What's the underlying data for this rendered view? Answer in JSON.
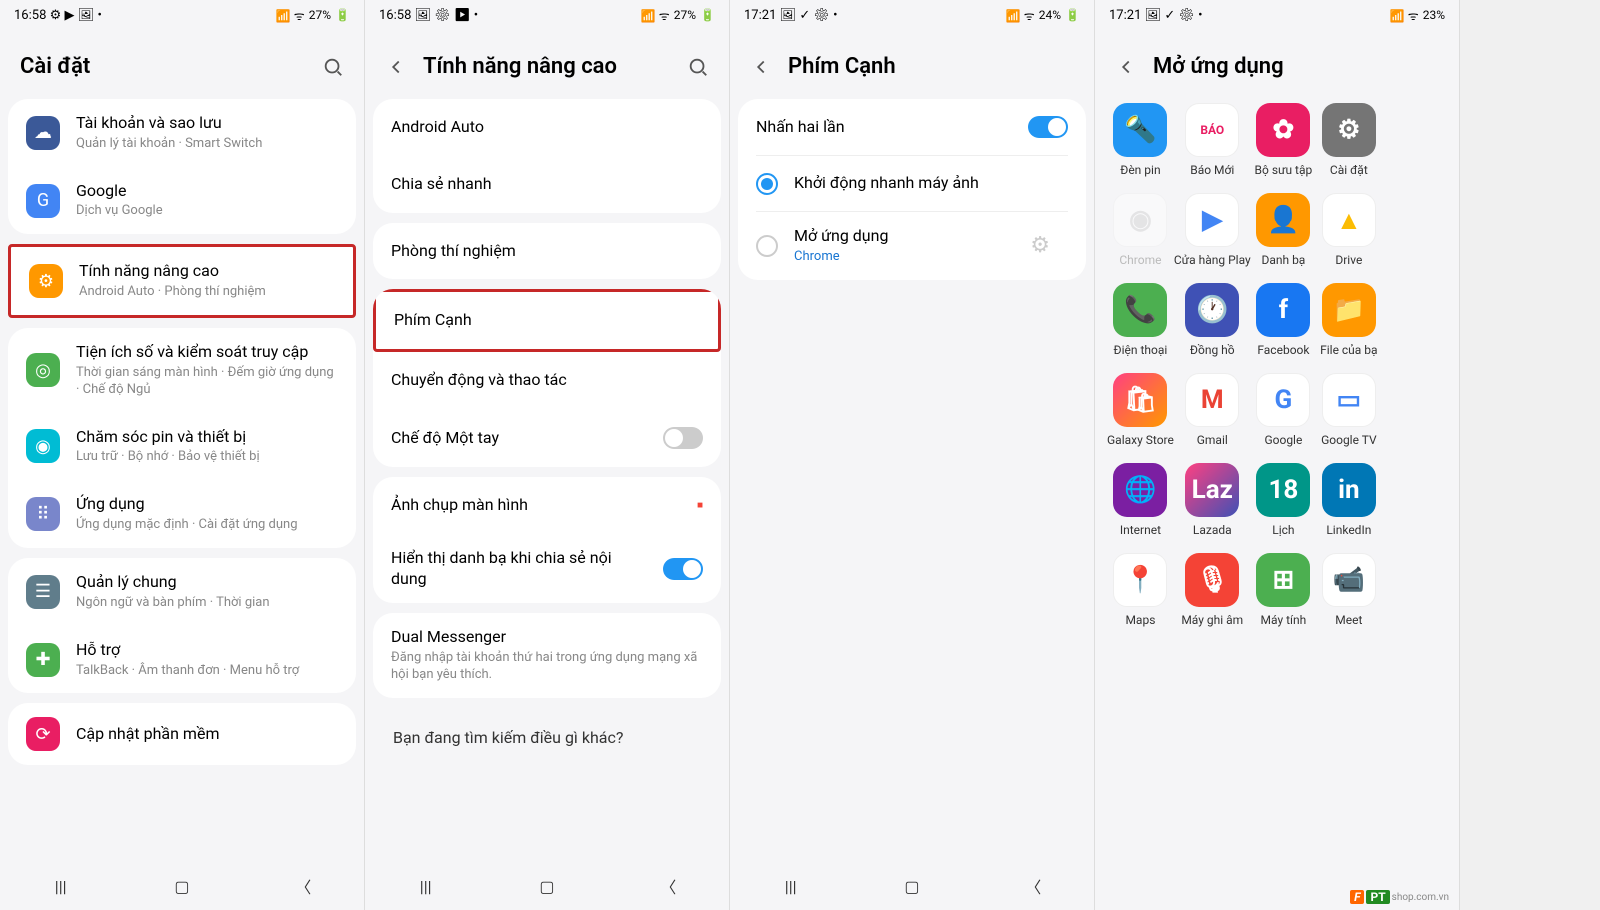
{
  "screen1": {
    "status": {
      "time": "16:58",
      "battery": "27%",
      "icons": "⚙ ▶ 🖼 •"
    },
    "title": "Cài đặt",
    "groups": [
      {
        "items": [
          {
            "icon": "sync",
            "bg": "#3b5998",
            "title": "Tài khoản và sao lưu",
            "sub": "Quản lý tài khoản · Smart Switch"
          },
          {
            "icon": "G",
            "bg": "#4285f4",
            "title": "Google",
            "sub": "Dịch vụ Google"
          }
        ]
      },
      {
        "highlight": true,
        "items": [
          {
            "icon": "gear",
            "bg": "#ff9800",
            "title": "Tính năng nâng cao",
            "sub": "Android Auto · Phòng thí nghiệm"
          }
        ]
      },
      {
        "items": [
          {
            "icon": "wellbeing",
            "bg": "#4caf50",
            "title": "Tiện ích số và kiểm soát truy cập",
            "sub": "Thời gian sáng màn hình · Đếm giờ ứng dụng · Chế độ Ngủ"
          },
          {
            "icon": "care",
            "bg": "#00bcd4",
            "title": "Chăm sóc pin và thiết bị",
            "sub": "Lưu trữ · Bộ nhớ · Bảo vệ thiết bị"
          },
          {
            "icon": "apps",
            "bg": "#7986cb",
            "title": "Ứng dụng",
            "sub": "Ứng dụng mặc định · Cài đặt ứng dụng"
          }
        ]
      },
      {
        "items": [
          {
            "icon": "general",
            "bg": "#607d8b",
            "title": "Quản lý chung",
            "sub": "Ngôn ngữ và bàn phím · Thời gian"
          },
          {
            "icon": "a11y",
            "bg": "#4caf50",
            "title": "Hỗ trợ",
            "sub": "TalkBack · Âm thanh đơn · Menu hỗ trợ"
          }
        ]
      },
      {
        "items": [
          {
            "icon": "update",
            "bg": "#e91e63",
            "title": "Cập nhật phần mềm",
            "sub": ""
          }
        ]
      }
    ]
  },
  "screen2": {
    "status": {
      "time": "16:58",
      "battery": "27%",
      "icons": "🖼 ⚙ ▶ •"
    },
    "title": "Tính năng nâng cao",
    "groups": [
      {
        "items": [
          {
            "title": "Android Auto"
          },
          {
            "title": "Chia sẻ nhanh"
          }
        ]
      },
      {
        "items": [
          {
            "title": "Phòng thí nghiệm"
          }
        ]
      },
      {
        "items": [
          {
            "title": "Phím Cạnh",
            "highlight": true
          },
          {
            "title": "Chuyển động và thao tác"
          },
          {
            "title": "Chế độ Một tay",
            "toggle": "off"
          }
        ]
      },
      {
        "items": [
          {
            "title": "Ảnh chụp màn hình"
          },
          {
            "title": "Hiển thị danh bạ khi chia sẻ nội dung",
            "toggle": "on"
          }
        ]
      },
      {
        "items": [
          {
            "title": "Dual Messenger",
            "sub": "Đăng nhập tài khoản thứ hai trong ứng dụng mạng xã hội bạn yêu thích."
          }
        ]
      }
    ],
    "footer": "Bạn đang tìm kiếm điều gì khác?"
  },
  "screen3": {
    "status": {
      "time": "17:21",
      "battery": "24%",
      "icons": "🖼 ✓ ⚙ •"
    },
    "title": "Phím Cạnh",
    "item1": {
      "title": "Nhấn hai lần",
      "toggle": "on"
    },
    "opt1": {
      "title": "Khởi động nhanh máy ảnh"
    },
    "opt2": {
      "title": "Mở ứng dụng",
      "sub": "Chrome"
    }
  },
  "screen4": {
    "status": {
      "time": "17:21",
      "battery": "23%",
      "icons": "🖼 ✓ ⚙ •"
    },
    "title": "Mở ứng dụng",
    "apps": [
      {
        "label": "Đèn pin",
        "bg": "#2196f3",
        "char": "🔦"
      },
      {
        "label": "Báo Mới",
        "bg": "#fff",
        "char": "BÁO",
        "fg": "#e91e63",
        "small": true
      },
      {
        "label": "Bộ sưu tập",
        "bg": "#e91e63",
        "char": "✿"
      },
      {
        "label": "Cài đặt",
        "bg": "#757575",
        "char": "⚙"
      },
      {
        "label": "",
        "bg": "transparent",
        "char": ""
      },
      {
        "label": "Chrome",
        "bg": "#fff",
        "char": "◉",
        "fg": "#ccc",
        "faded": true
      },
      {
        "label": "Cửa hàng Play",
        "bg": "#fff",
        "char": "▶",
        "fg": "#4285f4"
      },
      {
        "label": "Danh bạ",
        "bg": "#ff9800",
        "char": "👤"
      },
      {
        "label": "Drive",
        "bg": "#fff",
        "char": "▲",
        "fg": "#fbbc04"
      },
      {
        "label": "",
        "bg": "transparent",
        "char": ""
      },
      {
        "label": "Điện thoại",
        "bg": "#4caf50",
        "char": "📞"
      },
      {
        "label": "Đồng hồ",
        "bg": "#3f51b5",
        "char": "🕐"
      },
      {
        "label": "Facebook",
        "bg": "#1877f2",
        "char": "f"
      },
      {
        "label": "File của bạ",
        "bg": "#ff9800",
        "char": "📁"
      },
      {
        "label": "",
        "bg": "transparent",
        "char": ""
      },
      {
        "label": "Galaxy Store",
        "bg": "linear-gradient(135deg,#ff4081,#ff9800)",
        "char": "🛍"
      },
      {
        "label": "Gmail",
        "bg": "#fff",
        "char": "M",
        "fg": "#ea4335"
      },
      {
        "label": "Google",
        "bg": "#fff",
        "char": "G",
        "fg": "#4285f4"
      },
      {
        "label": "Google TV",
        "bg": "#fff",
        "char": "▭",
        "fg": "#4285f4"
      },
      {
        "label": "",
        "bg": "transparent",
        "char": ""
      },
      {
        "label": "Internet",
        "bg": "#7b1fa2",
        "char": "🌐"
      },
      {
        "label": "Lazada",
        "bg": "linear-gradient(135deg,#ff4081,#3f51b5)",
        "char": "Laz"
      },
      {
        "label": "Lịch",
        "bg": "#009688",
        "char": "18"
      },
      {
        "label": "LinkedIn",
        "bg": "#0077b5",
        "char": "in"
      },
      {
        "label": "",
        "bg": "transparent",
        "char": ""
      },
      {
        "label": "Maps",
        "bg": "#fff",
        "char": "📍",
        "fg": "#ea4335"
      },
      {
        "label": "Máy ghi âm",
        "bg": "#f44336",
        "char": "🎙"
      },
      {
        "label": "Máy tính",
        "bg": "#4caf50",
        "char": "⊞"
      },
      {
        "label": "Meet",
        "bg": "#fff",
        "char": "📹",
        "fg": "#00897b"
      },
      {
        "label": "",
        "bg": "transparent",
        "char": ""
      }
    ],
    "watermark": {
      "f": "F",
      "p": "PT",
      "t": "shop.com.vn"
    }
  }
}
